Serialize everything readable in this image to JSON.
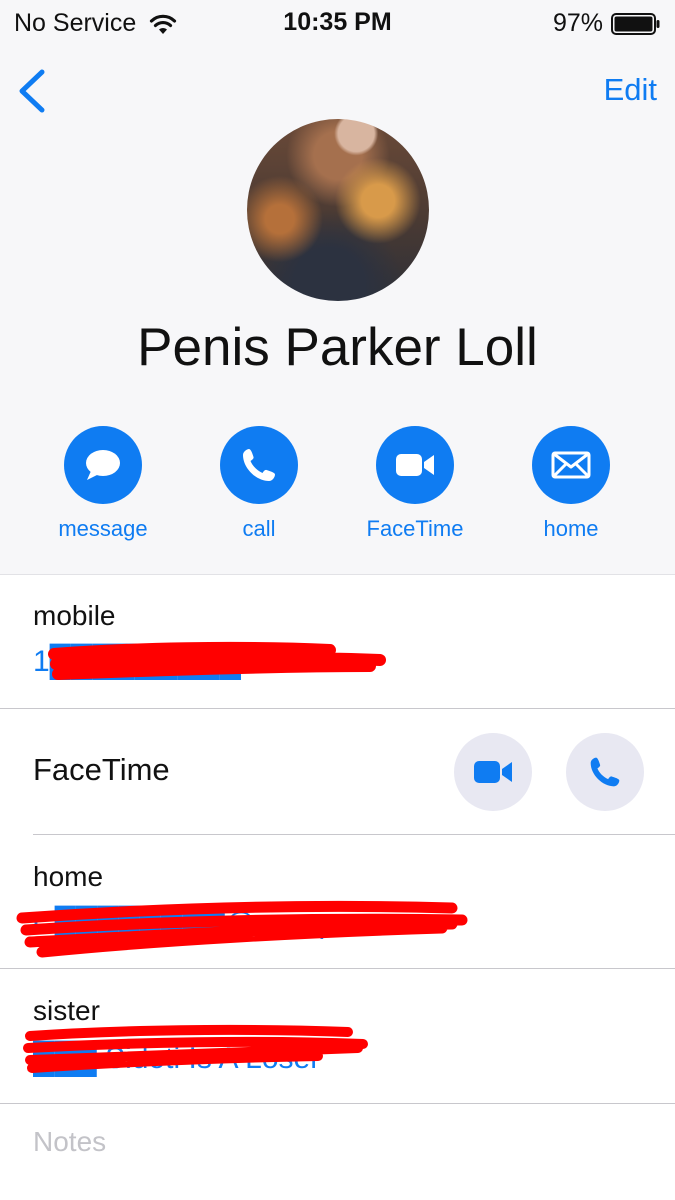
{
  "status_bar": {
    "carrier": "No Service",
    "time": "10:35 PM",
    "battery": "97%"
  },
  "nav": {
    "edit_label": "Edit"
  },
  "contact": {
    "name": "Penis Parker Loll"
  },
  "actions": [
    {
      "label": "message",
      "icon": "message-bubble-icon"
    },
    {
      "label": "call",
      "icon": "phone-icon"
    },
    {
      "label": "FaceTime",
      "icon": "video-camera-icon"
    },
    {
      "label": "home",
      "icon": "envelope-icon"
    }
  ],
  "fields": {
    "mobile": {
      "title": "mobile",
      "value": "1█████████26"
    },
    "facetime": {
      "title": "FaceTime"
    },
    "home": {
      "title": "home",
      "value": "C████████@nycap.rr.com"
    },
    "sister": {
      "title": "sister",
      "value": "███ Sidoti Is A Loser"
    }
  },
  "notes_placeholder": "Notes",
  "colors": {
    "accent": "#0f7cf2",
    "header_bg": "#f7f7f9",
    "redaction": "#ff0000"
  }
}
